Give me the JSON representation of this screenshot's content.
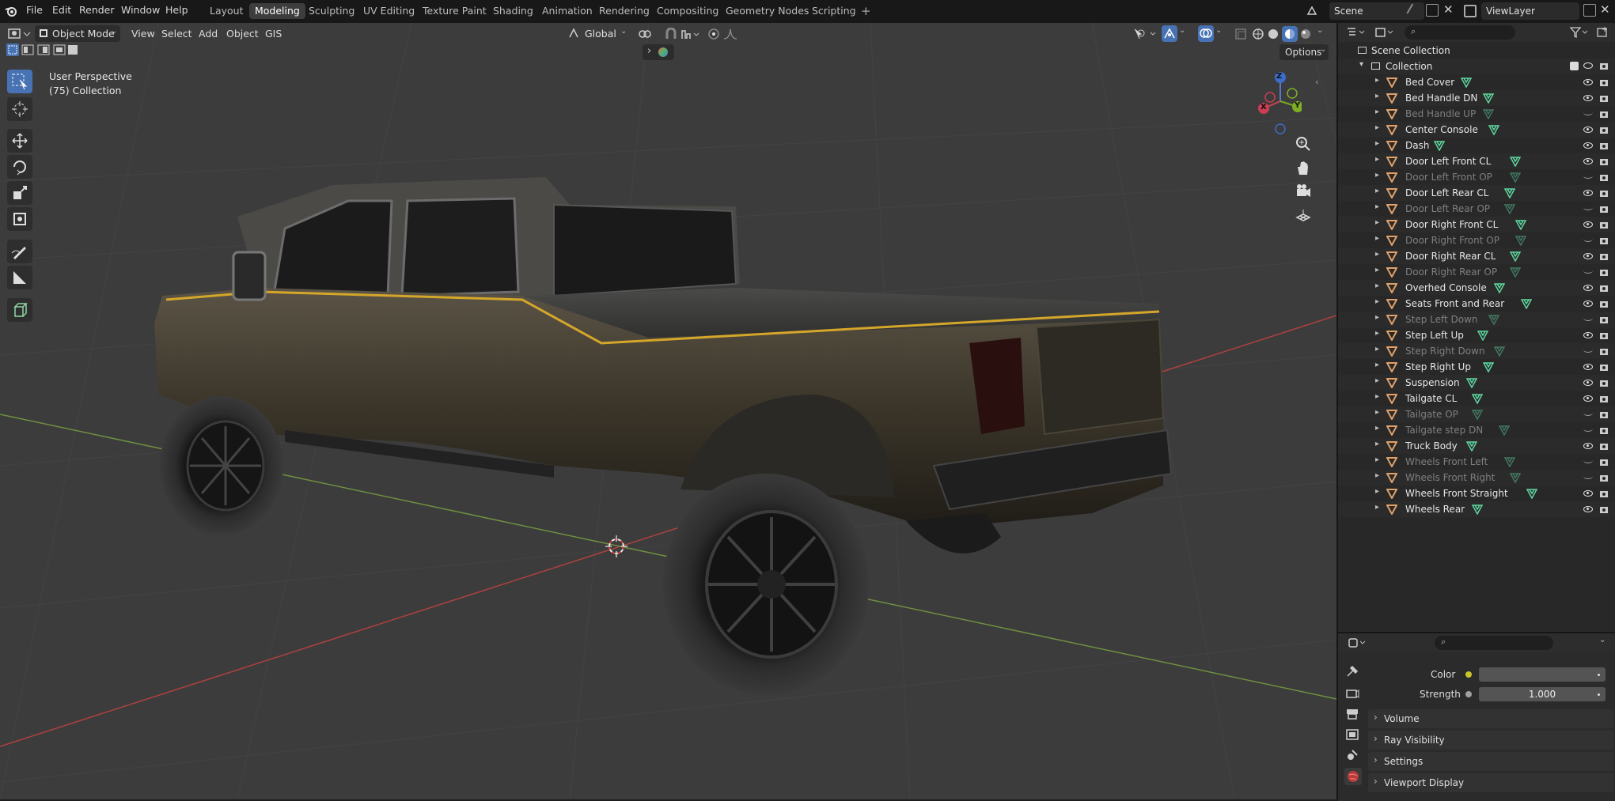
{
  "menu": {
    "file": "File",
    "edit": "Edit",
    "render": "Render",
    "window": "Window",
    "help": "Help"
  },
  "workspaces": [
    "Layout",
    "Modeling",
    "Sculpting",
    "UV Editing",
    "Texture Paint",
    "Shading",
    "Animation",
    "Rendering",
    "Compositing",
    "Geometry Nodes",
    "Scripting"
  ],
  "active_workspace": "Modeling",
  "scene_field": "Scene",
  "view_layer_field": "ViewLayer",
  "viewport_header": {
    "mode": "Object Mode",
    "view": "View",
    "select": "Select",
    "add": "Add",
    "object": "Object",
    "gis": "GIS",
    "transform_orientation": "Global",
    "options": "Options"
  },
  "viewport_overlay": {
    "perspective": "User Perspective",
    "collection": "(75) Collection"
  },
  "gizmo": {
    "x": "X",
    "y": "Y",
    "z": "Z"
  },
  "outliner": {
    "scene_collection": "Scene Collection",
    "collection": "Collection",
    "items": [
      {
        "name": "Bed Cover",
        "visible": true
      },
      {
        "name": "Bed Handle DN",
        "visible": true
      },
      {
        "name": "Bed Handle UP",
        "visible": false
      },
      {
        "name": "Center Console",
        "visible": true
      },
      {
        "name": "Dash",
        "visible": true
      },
      {
        "name": "Door Left Front CL",
        "visible": true
      },
      {
        "name": "Door Left Front OP",
        "visible": false
      },
      {
        "name": "Door Left Rear CL",
        "visible": true
      },
      {
        "name": "Door Left Rear OP",
        "visible": false
      },
      {
        "name": "Door Right Front CL",
        "visible": true
      },
      {
        "name": "Door Right Front OP",
        "visible": false
      },
      {
        "name": "Door Right Rear CL",
        "visible": true
      },
      {
        "name": "Door Right Rear OP",
        "visible": false
      },
      {
        "name": "Overhed Console",
        "visible": true
      },
      {
        "name": "Seats Front and Rear",
        "visible": true
      },
      {
        "name": "Step Left Down",
        "visible": false
      },
      {
        "name": "Step Left Up",
        "visible": true
      },
      {
        "name": "Step Right Down",
        "visible": false
      },
      {
        "name": "Step Right Up",
        "visible": true
      },
      {
        "name": "Suspension",
        "visible": true
      },
      {
        "name": "Tailgate CL",
        "visible": true
      },
      {
        "name": "Tailgate OP",
        "visible": false
      },
      {
        "name": "Tailgate step DN",
        "visible": false
      },
      {
        "name": "Truck Body",
        "visible": true
      },
      {
        "name": "Wheels Front Left",
        "visible": false
      },
      {
        "name": "Wheels Front Right",
        "visible": false
      },
      {
        "name": "Wheels Front Straight",
        "visible": true
      },
      {
        "name": "Wheels Rear",
        "visible": true
      }
    ]
  },
  "properties": {
    "color_label": "Color",
    "strength_label": "Strength",
    "strength_value": "1.000",
    "panels": [
      "Volume",
      "Ray Visibility",
      "Settings",
      "Viewport Display"
    ]
  },
  "colors": {
    "accent": "#4772b3",
    "object_orange": "#e0a06a",
    "mesh_green": "#5fd6a0",
    "stripe_yellow": "#d4a62a"
  }
}
